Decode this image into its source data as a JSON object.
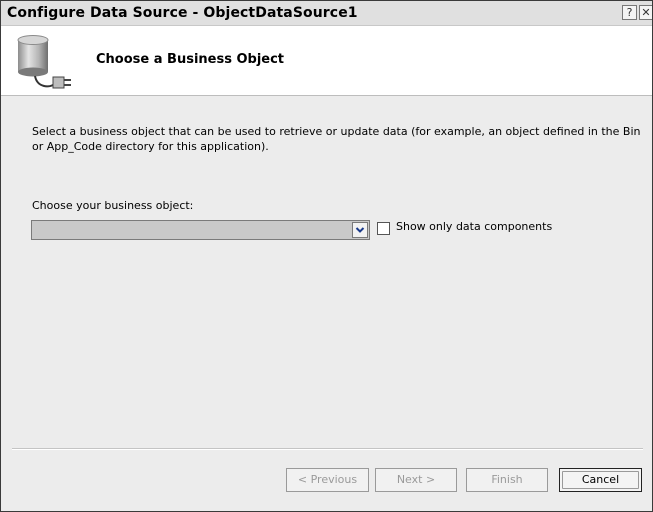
{
  "window": {
    "title": "Configure Data Source - ObjectDataSource1",
    "help_glyph": "?",
    "close_glyph": "✕"
  },
  "header": {
    "title": "Choose a Business Object",
    "icon": "database-plug-icon"
  },
  "body": {
    "description": "Select a business object that can be used to retrieve or update data (for example, an object defined in the Bin or App_Code directory for this application).",
    "choose_label": "Choose your business object:",
    "business_object_value": "",
    "show_only_label": "Show only data components",
    "show_only_checked": false
  },
  "buttons": {
    "previous": "< Previous",
    "next": "Next >",
    "finish": "Finish",
    "cancel": "Cancel"
  },
  "colors": {
    "dialog_bg": "#ececec",
    "header_bg": "#ffffff",
    "disabled_text": "#9a9a9a"
  }
}
